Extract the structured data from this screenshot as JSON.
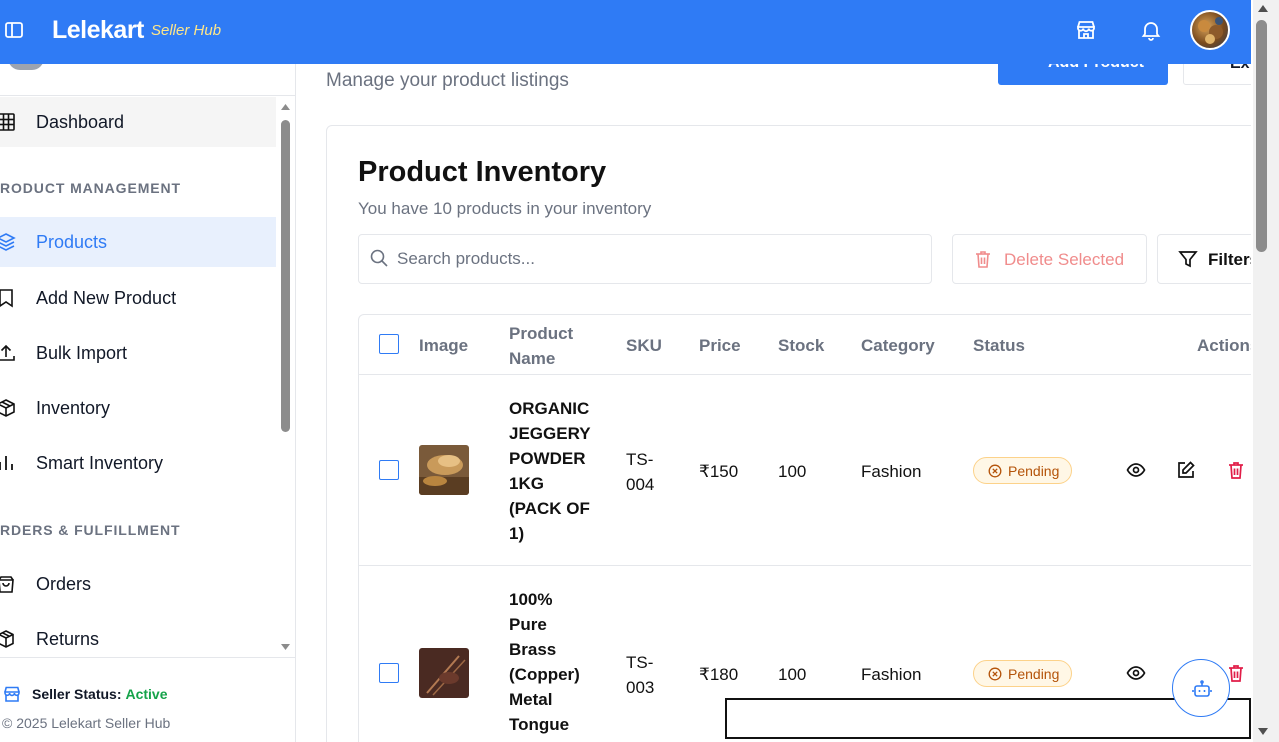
{
  "header": {
    "brand": "Lelekart",
    "brand_sub": "Seller Hub",
    "icons": [
      "sidebar-toggle-icon",
      "store-icon",
      "bell-icon",
      "avatar"
    ],
    "brand_color": "#2f7bf5"
  },
  "sidebar": {
    "items": [
      {
        "label": "Dashboard",
        "icon": "grid-icon"
      },
      {
        "label": "Products",
        "icon": "layers-icon",
        "active": true
      },
      {
        "label": "Add New Product",
        "icon": "bookmark-icon"
      },
      {
        "label": "Bulk Import",
        "icon": "upload-icon"
      },
      {
        "label": "Inventory",
        "icon": "box-icon"
      },
      {
        "label": "Smart Inventory",
        "icon": "bar-chart-icon"
      },
      {
        "label": "Orders",
        "icon": "shopping-bag-icon"
      },
      {
        "label": "Returns",
        "icon": "package-return-icon"
      }
    ],
    "sections": [
      "RODUCT MANAGEMENT",
      "RDERS & FULFILLMENT"
    ],
    "seller_status_label": "Seller Status:",
    "seller_status_value": "Active",
    "copyright": "© 2025 Lelekart Seller Hub"
  },
  "main": {
    "subtitle": "Manage your product listings",
    "add_button": "Add Product",
    "export_button": "Ex",
    "card_title": "Product Inventory",
    "card_subtitle": "You have 10 products in your inventory",
    "search_placeholder": "Search products...",
    "delete_selected": "Delete Selected",
    "filters": "Filters"
  },
  "table": {
    "headers": [
      "Image",
      "Product Name",
      "SKU",
      "Price",
      "Stock",
      "Category",
      "Status",
      "Actions"
    ],
    "rows": [
      {
        "name": "ORGANIC JEGGERY POWDER 1KG (PACK OF 1)",
        "sku": "TS-004",
        "price": "₹150",
        "stock": "100",
        "category": "Fashion",
        "status": "Pending"
      },
      {
        "name": "100% Pure Brass (Copper) Metal Tongue",
        "sku": "TS-003",
        "price": "₹180",
        "stock": "100",
        "category": "Fashion",
        "status": "Pending"
      }
    ]
  }
}
